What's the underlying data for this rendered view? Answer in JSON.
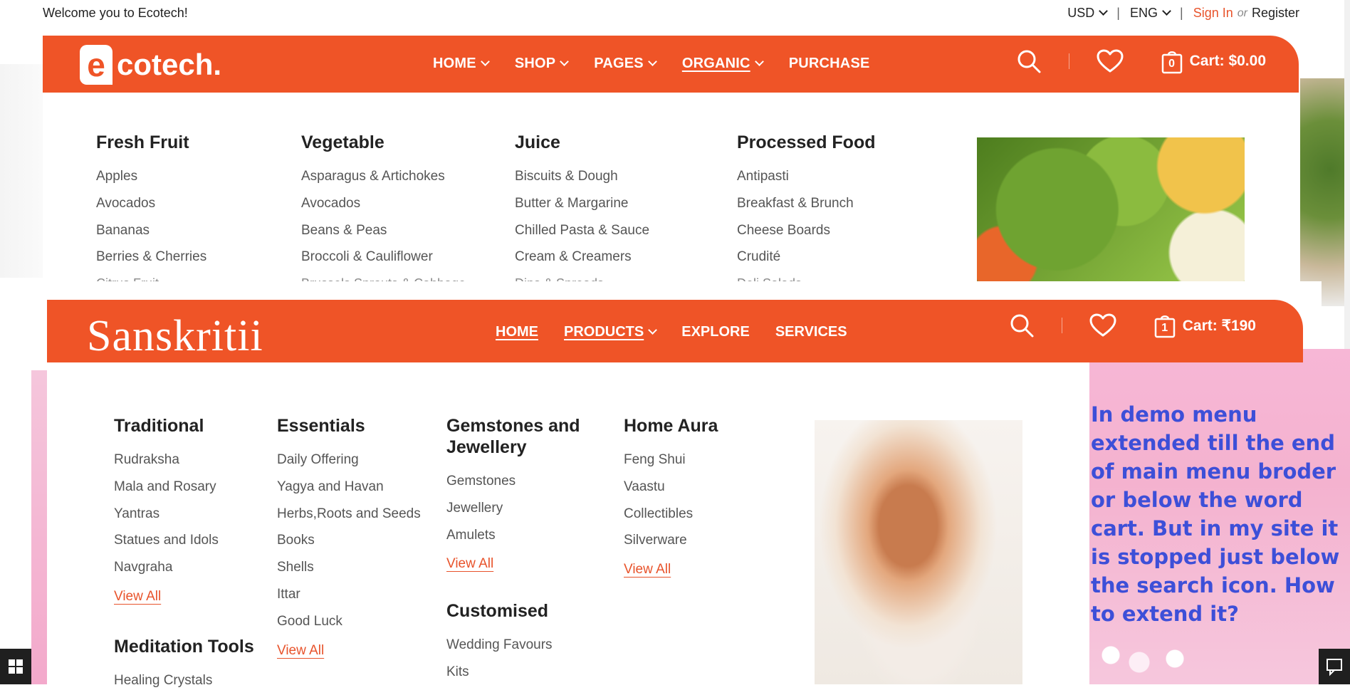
{
  "topbar": {
    "welcome": "Welcome you to Ecotech!",
    "currency": "USD",
    "language": "ENG",
    "separator": "|",
    "sign_in": "Sign In",
    "or": "or",
    "register": "Register"
  },
  "header1": {
    "logo_letter": "e",
    "logo_text": "cotech.",
    "nav": [
      "HOME",
      "SHOP",
      "PAGES",
      "ORGANIC",
      "PURCHASE"
    ],
    "cart_count": "0",
    "cart_label": "Cart: $0.00"
  },
  "mega1": {
    "columns": [
      {
        "title": "Fresh Fruit",
        "items": [
          "Apples",
          "Avocados",
          "Bananas",
          "Berries & Cherries"
        ],
        "cut": "Citrus Fruit"
      },
      {
        "title": "Vegetable",
        "items": [
          "Asparagus & Artichokes",
          "Avocados",
          "Beans & Peas",
          "Broccoli & Cauliflower"
        ],
        "cut": "Brussels Sprouts & Cabbage"
      },
      {
        "title": "Juice",
        "items": [
          "Biscuits & Dough",
          "Butter & Margarine",
          "Chilled Pasta & Sauce",
          "Cream & Creamers"
        ],
        "cut": "Dips & Spreads"
      },
      {
        "title": "Processed Food",
        "items": [
          "Antipasti",
          "Breakfast & Brunch",
          "Cheese Boards",
          "Crudité"
        ],
        "cut": "Deli Salads"
      }
    ]
  },
  "header2": {
    "logo_text": "Sanskritii",
    "nav": [
      "HOME",
      "PRODUCTS",
      "EXPLORE",
      "SERVICES"
    ],
    "cart_count": "1",
    "cart_label": "Cart: ₹190"
  },
  "mega2": {
    "columns": [
      {
        "title": "Traditional",
        "items": [
          "Rudraksha",
          "Mala and Rosary",
          "Yantras",
          "Statues and Idols",
          "Navgraha"
        ],
        "view_all": "View All"
      },
      {
        "title": "Essentials",
        "items": [
          "Daily Offering",
          "Yagya and Havan",
          "Herbs,Roots and Seeds",
          "Books",
          "Shells",
          "Ittar",
          "Good Luck"
        ],
        "view_all": "View All"
      },
      {
        "title": "Gemstones and Jewellery",
        "items": [
          "Gemstones",
          "Jewellery",
          "Amulets"
        ],
        "view_all": "View All"
      },
      {
        "title": "Home Aura",
        "items": [
          "Feng Shui",
          "Vaastu",
          "Collectibles",
          "Silverware"
        ],
        "view_all": "View All"
      }
    ],
    "meditation": {
      "title": "Meditation Tools",
      "items": [
        "Healing Crystals"
      ]
    },
    "customised": {
      "title": "Customised",
      "items": [
        "Wedding Favours",
        "Kits"
      ]
    }
  },
  "question": "In demo menu extended till the end of main menu broder or below the word cart. But in my site it is stopped just below the search icon. How to extend it?",
  "colors": {
    "brand": "#ef5427",
    "link": "#e8532b",
    "question": "#3d4fd8"
  }
}
